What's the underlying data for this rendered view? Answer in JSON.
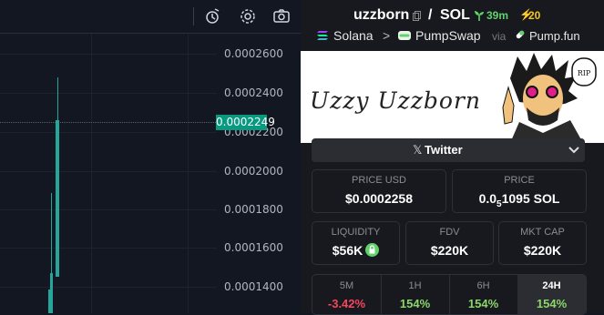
{
  "chart": {
    "price_ticks": [
      "0.0002600",
      "0.0002400",
      "0.0002200",
      "0.0002000",
      "0.0001800",
      "0.0001600",
      "0.0001400"
    ],
    "current_price": "0.0002249",
    "up_color": "#26a69a",
    "toolbar_icons": [
      "indicator-icon",
      "settings-icon",
      "camera-icon"
    ]
  },
  "header": {
    "name": "uzzborn",
    "slash": "/",
    "quote": "SOL",
    "age": "39m",
    "boosts": "20"
  },
  "breadcrumbs": {
    "chain": "Solana",
    "separator": ">",
    "dex": "PumpSwap",
    "via": "via",
    "launchpad": "Pump.fun"
  },
  "banner": {
    "text": "Uzzy Uzzborn",
    "badge": "RIP"
  },
  "socials": {
    "x_glyph": "𝕏",
    "label": "Twitter"
  },
  "stats": {
    "price_usd": {
      "label": "PRICE USD",
      "value": "$0.0002258"
    },
    "price": {
      "label": "PRICE",
      "value_prefix": "0.0",
      "value_sub": "5",
      "value_suffix": "1095 SOL"
    },
    "liquidity": {
      "label": "LIQUIDITY",
      "value": "$56K"
    },
    "fdv": {
      "label": "FDV",
      "value": "$220K"
    },
    "mkt_cap": {
      "label": "MKT CAP",
      "value": "$220K"
    }
  },
  "timeframes": [
    {
      "label": "5M",
      "value": "-3.42%",
      "color": "#f6465d"
    },
    {
      "label": "1H",
      "value": "154%",
      "color": "#8bd66a"
    },
    {
      "label": "6H",
      "value": "154%",
      "color": "#8bd66a"
    },
    {
      "label": "24H",
      "value": "154%",
      "color": "#8bd66a"
    }
  ]
}
